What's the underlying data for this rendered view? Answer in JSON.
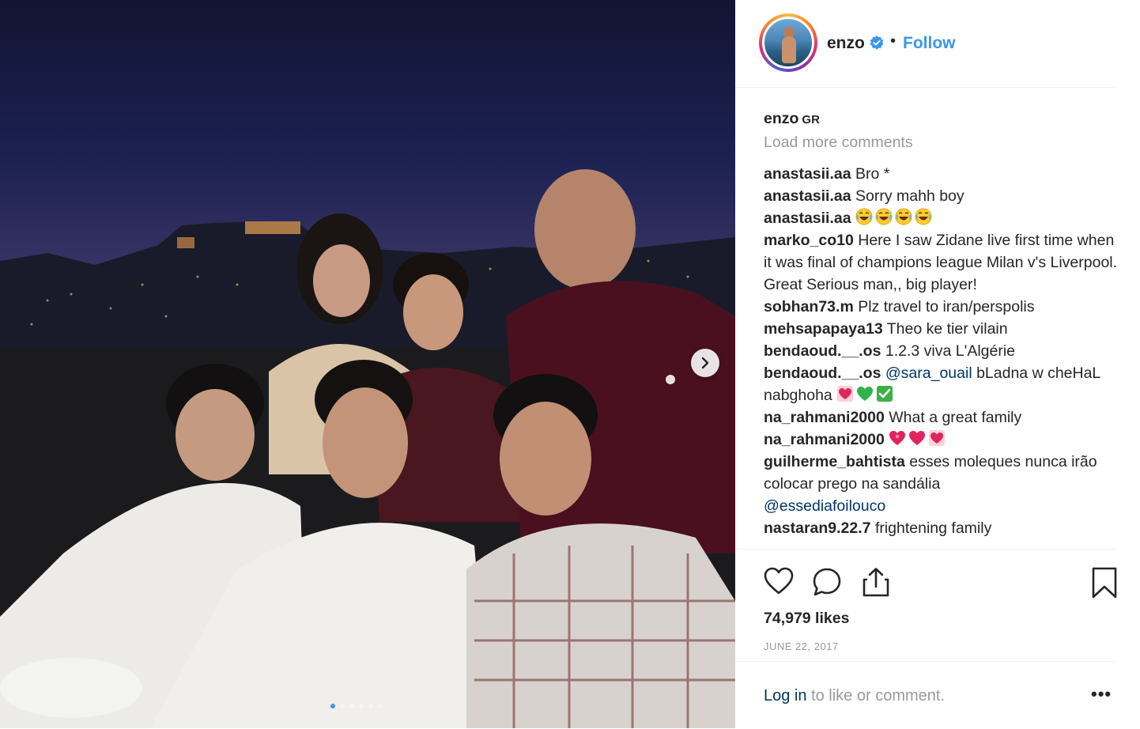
{
  "post": {
    "username": "enzo",
    "follow_label": "Follow",
    "separator": "•",
    "caption": {
      "username": "enzo",
      "text": "GR"
    },
    "load_more": "Load more comments",
    "comments": [
      {
        "user": "anastasii.aa",
        "text": "Bro *"
      },
      {
        "user": "anastasii.aa",
        "text": "Sorry mahh boy"
      },
      {
        "user": "anastasii.aa",
        "text": "",
        "emoji": [
          "laughing-face",
          "laughing-face",
          "laughing-face",
          "laughing-face"
        ]
      },
      {
        "user": "marko_co10",
        "text": "Here I saw Zidane live first time when it was final of champions league Milan v's Liverpool. Great Serious man,, big player!"
      },
      {
        "user": "sobhan73.m",
        "text": "Plz travel to iran/perspolis"
      },
      {
        "user": "mehsapapaya13",
        "text": "Theo ke tier vilain"
      },
      {
        "user": "bendaoud.__.os",
        "text": "1.2.3 viva L'Algérie"
      },
      {
        "user": "bendaoud.__.os",
        "mention": "@sara_ouail",
        "text": "bLadna w cheHaL nabghoha",
        "emoji": [
          "sparkling-heart",
          "green-heart",
          "check-mark"
        ]
      },
      {
        "user": "na_rahmani2000",
        "text": "What a great family"
      },
      {
        "user": "na_rahmani2000",
        "text": "",
        "emoji": [
          "heart-exclamation",
          "red-heart",
          "sparkling-heart"
        ]
      },
      {
        "user": "guilherme_bahtista",
        "text": "esses moleques nunca irão colocar prego na sandália"
      },
      {
        "user": "",
        "mention": "@essediafoilouco",
        "text": ""
      },
      {
        "user": "nastaran9.22.7",
        "text": "frightening family"
      }
    ],
    "likes": "74,979 likes",
    "date": "JUNE 22, 2017",
    "login_link": "Log in",
    "login_text": " to like or comment.",
    "more_label": "•••"
  },
  "icons": {
    "verified": "verified-badge-icon",
    "next": "chevron-right-icon",
    "like": "heart-icon",
    "comment": "comment-icon",
    "share": "share-icon",
    "save": "bookmark-icon",
    "more": "more-options-icon"
  },
  "carousel": {
    "count": 6,
    "active_index": 0
  },
  "colors": {
    "link": "#3897f0",
    "muted": "#999999",
    "mention": "#003569",
    "text": "#262626"
  }
}
